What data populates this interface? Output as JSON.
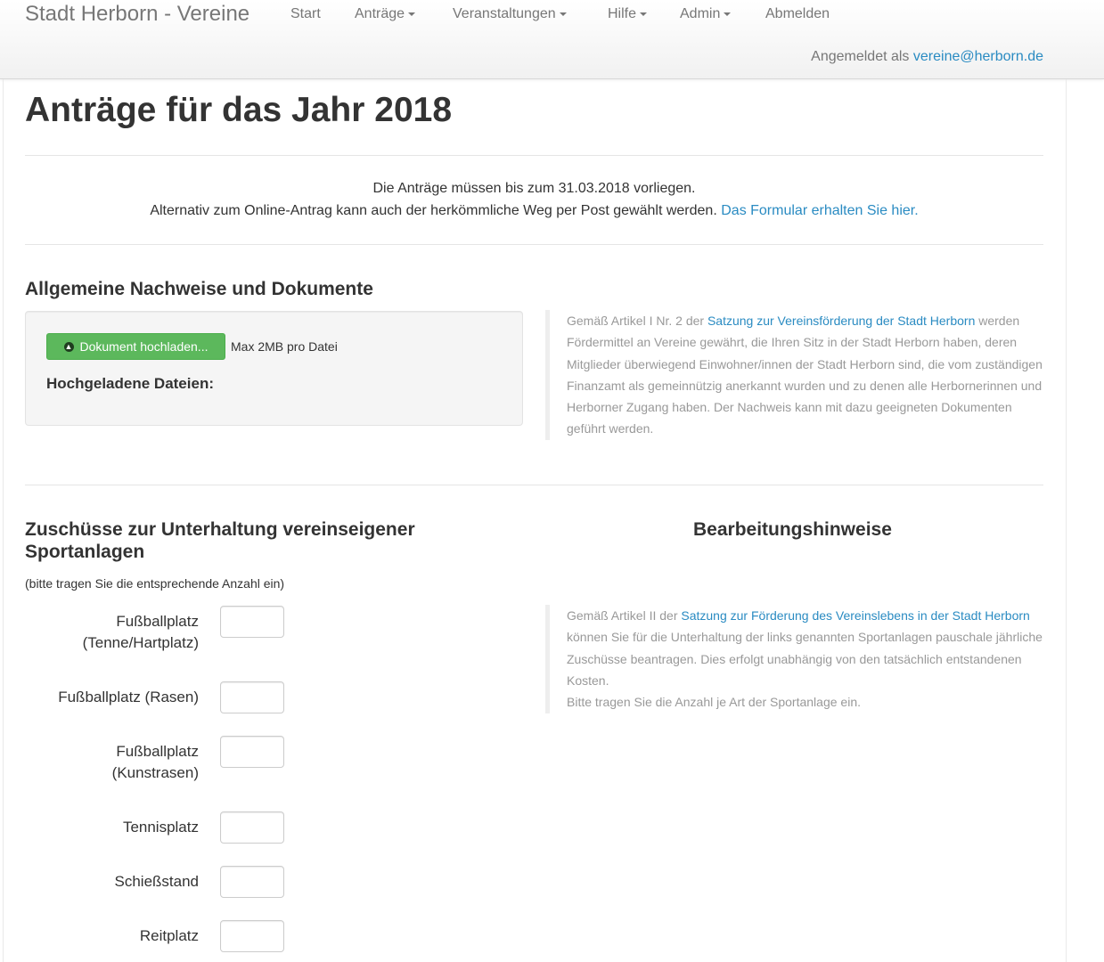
{
  "nav": {
    "brand": "Stadt Herborn - Vereine",
    "items": [
      {
        "label": "Start",
        "dropdown": false
      },
      {
        "label": "Anträge",
        "dropdown": true
      },
      {
        "label": "Veranstaltungen",
        "dropdown": true
      },
      {
        "label": "Hilfe",
        "dropdown": true
      },
      {
        "label": "Admin",
        "dropdown": true
      },
      {
        "label": "Abmelden",
        "dropdown": false
      }
    ],
    "signed_in_prefix": "Angemeldet als",
    "signed_in_user": "vereine@herborn.de"
  },
  "page": {
    "title": "Anträge für das Jahr 2018",
    "notice_line1": "Die Anträge müssen bis zum 31.03.2018 vorliegen.",
    "notice_line2": "Alternativ zum Online-Antrag kann auch der herkömmliche Weg per Post gewählt werden.",
    "notice_link": "Das Formular erhalten Sie hier."
  },
  "documents": {
    "title": "Allgemeine Nachweise und Dokumente",
    "upload_button": "Dokument hochladen...",
    "max_size": "Max 2MB pro Datei",
    "uploaded_label": "Hochgeladene Dateien:",
    "info_prefix": "Gemäß Artikel I Nr. 2 der",
    "info_link": "Satzung zur Vereinsförderung der Stadt Herborn",
    "info_suffix": "werden Fördermittel an Vereine gewährt, die Ihren Sitz in der Stadt Herborn haben, deren Mitglieder überwiegend Einwohner/innen der Stadt Herborn sind, die vom zuständigen Finanzamt als gemeinnützig anerkannt wurden und zu denen alle Herbornerinnen und Herborner Zugang haben. Der Nachweis kann mit dazu geeigneten Dokumenten geführt werden."
  },
  "sports": {
    "title": "Zuschüsse zur Unterhaltung vereinseigener Sportanlagen",
    "hint": "(bitte tragen Sie die entsprechende Anzahl ein)",
    "notes_title": "Bearbeitungshinweise",
    "info_prefix": "Gemäß Artikel II der",
    "info_link": "Satzung zur Förderung des Vereinslebens in der Stadt Herborn",
    "info_suffix": "können Sie für die Unterhaltung der links genannten Sportanlagen pauschale jährliche Zuschüsse beantragen. Dies erfolgt unabhängig von den tatsächlich entstandenen Kosten.",
    "info_line2": "Bitte tragen Sie die Anzahl je Art der Sportanlage ein.",
    "fields": [
      {
        "line1": "Fußballplatz",
        "line2": "(Tenne/Hartplatz)",
        "value": ""
      },
      {
        "line1": "Fußballplatz (Rasen)",
        "line2": "",
        "value": ""
      },
      {
        "line1": "Fußballplatz",
        "line2": "(Kunstrasen)",
        "value": ""
      },
      {
        "line1": "Tennisplatz",
        "line2": "",
        "value": ""
      },
      {
        "line1": "Schießstand",
        "line2": "",
        "value": ""
      },
      {
        "line1": "Reitplatz",
        "line2": "",
        "value": ""
      }
    ]
  }
}
